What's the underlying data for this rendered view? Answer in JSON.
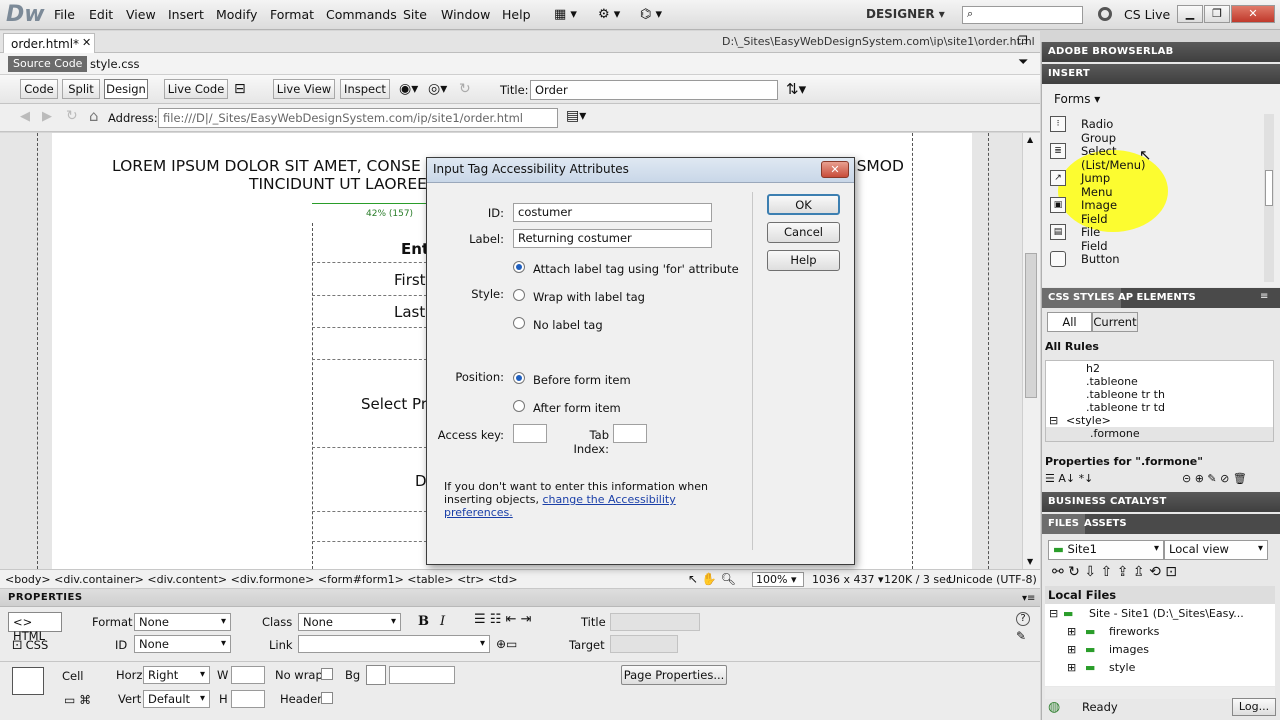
{
  "app": {
    "logo": "Dw",
    "workspace": "DESIGNER",
    "cs_live": "CS Live"
  },
  "menu": [
    "File",
    "Edit",
    "View",
    "Insert",
    "Modify",
    "Format",
    "Commands",
    "Site",
    "Window",
    "Help"
  ],
  "doc": {
    "tabs": [
      "order.html*",
      "style.css"
    ],
    "path": "D:\\_Sites\\EasyWebDesignSystem.com\\ip\\site1\\order.html",
    "related": [
      "Source Code",
      "style.css"
    ],
    "view_buttons": [
      "Code",
      "Split",
      "Design"
    ],
    "live_buttons": [
      "Live Code",
      "Live View",
      "Inspect"
    ],
    "title_label": "Title:",
    "title_value": "Order",
    "address_label": "Address:",
    "address_value": "file:///D|/_Sites/EasyWebDesignSystem.com/ip/site1/order.html"
  },
  "page": {
    "heading_line1": "LOREM IPSUM DOLOR SIT AMET, CONSE",
    "heading_line1_tail": "ISMOD",
    "heading_line2": "TINCIDUNT UT LAOREE",
    "table_width": "42% (157)",
    "cells": [
      "Ent",
      "First",
      "Last",
      "Select Pr",
      "D"
    ]
  },
  "statusbar": {
    "tags": "<body> <div.container> <div.content> <div.formone> <form#form1> <table> <tr> <td>",
    "zoom": "100%",
    "size": "1036 x 437",
    "download": "120K / 3 sec",
    "encoding": "Unicode (UTF-8)"
  },
  "properties": {
    "title": "PROPERTIES",
    "html_btn": "HTML",
    "css_btn": "CSS",
    "format_label": "Format",
    "format_value": "None",
    "class_label": "Class",
    "class_value": "None",
    "id_label": "ID",
    "id_value": "None",
    "link_label": "Link",
    "title_label": "Title",
    "target_label": "Target",
    "cell_label": "Cell",
    "horz_label": "Horz",
    "horz_value": "Right",
    "vert_label": "Vert",
    "vert_value": "Default",
    "w_label": "W",
    "h_label": "H",
    "nowrap_label": "No wrap",
    "bg_label": "Bg",
    "header_label": "Header",
    "page_props": "Page Properties..."
  },
  "dialog": {
    "title": "Input Tag Accessibility Attributes",
    "id_label": "ID:",
    "id_value": "costumer",
    "label_label": "Label:",
    "label_value": "Returning costumer",
    "style_label": "Style:",
    "style_options": [
      "Attach label tag using 'for' attribute",
      "Wrap with label tag",
      "No label tag"
    ],
    "position_label": "Position:",
    "position_options": [
      "Before form item",
      "After form item"
    ],
    "access_label": "Access key:",
    "tab_label": "Tab Index:",
    "note": "If you don't want to enter this information when inserting objects,",
    "note_link": "change the Accessibility preferences.",
    "ok": "OK",
    "cancel": "Cancel",
    "help": "Help"
  },
  "right": {
    "browserlab": "ADOBE BROWSERLAB",
    "insert": "INSERT",
    "category": "Forms",
    "insert_items": [
      "Radio Group",
      "Select (List/Menu)",
      "Jump Menu",
      "Image Field",
      "File Field",
      "Button"
    ],
    "css_tabs": [
      "CSS STYLES",
      "AP ELEMENTS"
    ],
    "css_modes": [
      "All",
      "Current"
    ],
    "all_rules": "All Rules",
    "rules": [
      "h2",
      ".tableone",
      ".tableone tr th",
      ".tableone tr td",
      "<style>",
      ".formone"
    ],
    "properties_for": "Properties for \".formone\"",
    "business": "BUSINESS CATALYST",
    "files_tabs": [
      "FILES",
      "ASSETS"
    ],
    "site": "Site1",
    "view": "Local view",
    "local_files": "Local Files",
    "tree": [
      "Site - Site1 (D:\\_Sites\\Easy...",
      "fireworks",
      "images",
      "style"
    ],
    "ready": "Ready",
    "log": "Log..."
  }
}
